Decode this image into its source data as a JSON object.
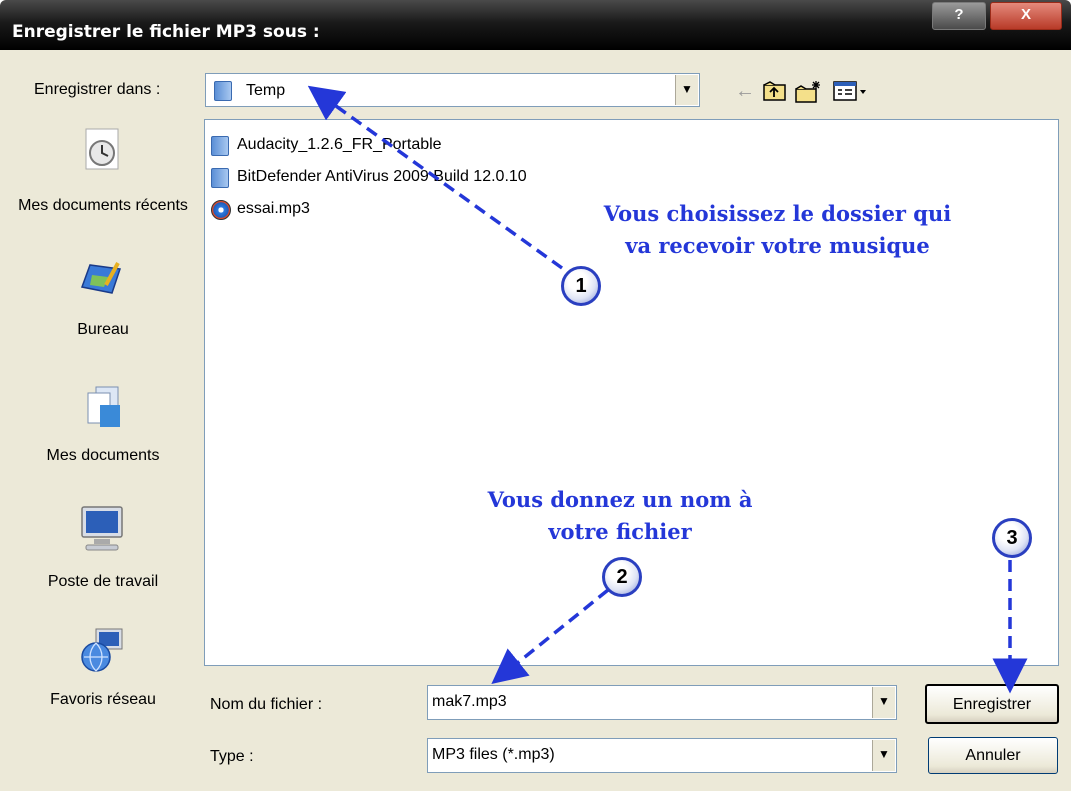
{
  "window": {
    "title": "Enregistrer le fichier MP3 sous :",
    "help_label": "?",
    "close_label": "X"
  },
  "save_in": {
    "label": "Enregistrer dans :",
    "value": "Temp"
  },
  "toolbar": {
    "icons": [
      "back-arrow-icon",
      "up-folder-icon",
      "new-folder-icon",
      "view-menu-icon"
    ]
  },
  "places": [
    {
      "label": "Mes documents récents",
      "icon": "recent-documents-icon"
    },
    {
      "label": "Bureau",
      "icon": "desktop-icon"
    },
    {
      "label": "Mes documents",
      "icon": "my-documents-icon"
    },
    {
      "label": "Poste de travail",
      "icon": "my-computer-icon"
    },
    {
      "label": "Favoris réseau",
      "icon": "network-icon"
    }
  ],
  "files": [
    {
      "name": "Audacity_1.2.6_FR_Portable",
      "icon": "folder-icon"
    },
    {
      "name": "BitDefender AntiVirus 2009 Build 12.0.10",
      "icon": "folder-icon"
    },
    {
      "name": "essai.mp3",
      "icon": "mp3-file-icon"
    }
  ],
  "filename": {
    "label": "Nom du fichier :",
    "value": "mak7.mp3"
  },
  "filetype": {
    "label": "Type :",
    "value": "MP3 files (*.mp3)"
  },
  "buttons": {
    "save": "Enregistrer",
    "cancel": "Annuler"
  },
  "annotations": {
    "note1_line1": "Vous choisissez le dossier qui",
    "note1_line2": "va recevoir votre musique",
    "note2_line1": "Vous donnez un nom à",
    "note2_line2": "votre fichier",
    "badge1": "1",
    "badge2": "2",
    "badge3": "3"
  },
  "colors": {
    "annotation": "#2437d8",
    "window_bg": "#ece9d8",
    "titlebar": "#000000"
  }
}
